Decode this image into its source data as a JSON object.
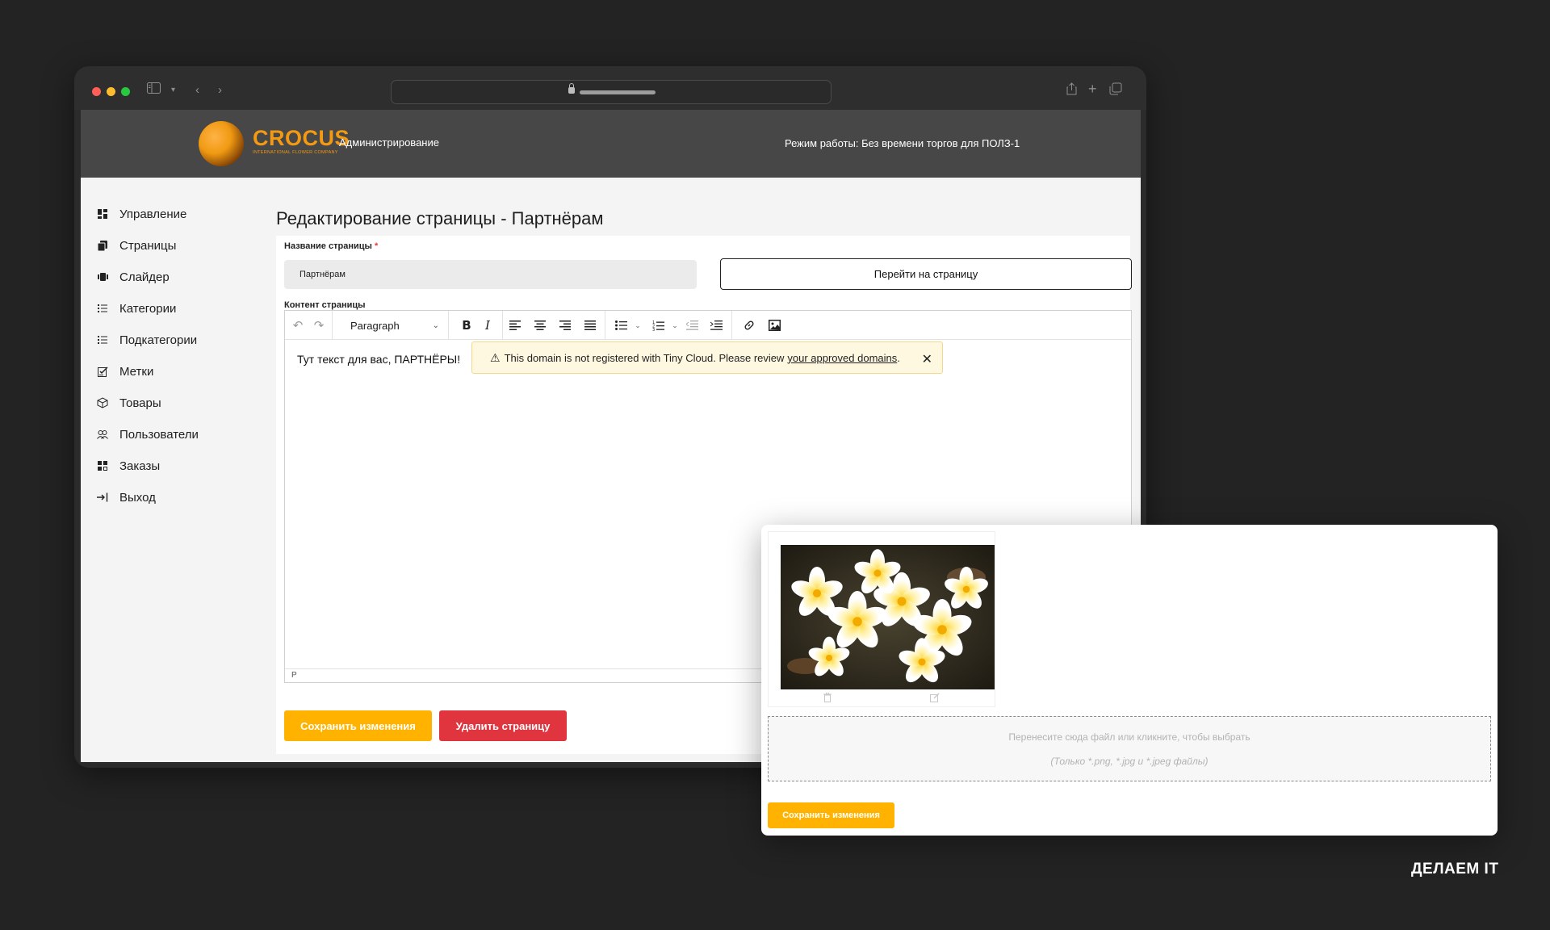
{
  "header": {
    "logo_text": "CROCUS",
    "logo_subtext": "INTERNATIONAL FLOWER COMPANY",
    "admin_label": "Администрирование",
    "mode_label": "Режим работы: Без времени торгов для ПОЛЗ-1"
  },
  "sidebar": {
    "items": [
      {
        "label": "Управление",
        "icon": "dashboard-icon"
      },
      {
        "label": "Страницы",
        "icon": "pages-icon"
      },
      {
        "label": "Слайдер",
        "icon": "slider-icon"
      },
      {
        "label": "Категории",
        "icon": "list-icon"
      },
      {
        "label": "Подкатегории",
        "icon": "list-icon"
      },
      {
        "label": "Метки",
        "icon": "tag-icon"
      },
      {
        "label": "Товары",
        "icon": "box-icon"
      },
      {
        "label": "Пользователи",
        "icon": "users-icon"
      },
      {
        "label": "Заказы",
        "icon": "orders-icon"
      },
      {
        "label": "Выход",
        "icon": "logout-icon"
      }
    ]
  },
  "main": {
    "title": "Редактирование страницы - Партнёрам",
    "name_label": "Название страницы",
    "required_mark": "*",
    "name_value": "Партнёрам",
    "goto_button": "Перейти на страницу",
    "content_label": "Контент страницы",
    "editor": {
      "format": "Paragraph",
      "content": "Тут текст для вас, ПАРТНЁРЫ!",
      "banner_text": "This domain is not registered with Tiny Cloud. Please review",
      "banner_link": "your approved domains",
      "banner_end": ".",
      "status_path": "P"
    },
    "save_button": "Сохранить изменения",
    "delete_button": "Удалить страницу"
  },
  "image_modal": {
    "dropzone_text": "Перенесите сюда файл или кликните, чтобы выбрать",
    "dropzone_hint": "(Только *.png, *.jpg и *.jpeg файлы)",
    "save_button": "Сохранить изменения"
  },
  "brand": "ДЕЛАЕМ IT",
  "colors": {
    "accent": "#ffb300",
    "danger": "#e0353f",
    "header_bg": "#474747",
    "logo": "#f39a12"
  }
}
